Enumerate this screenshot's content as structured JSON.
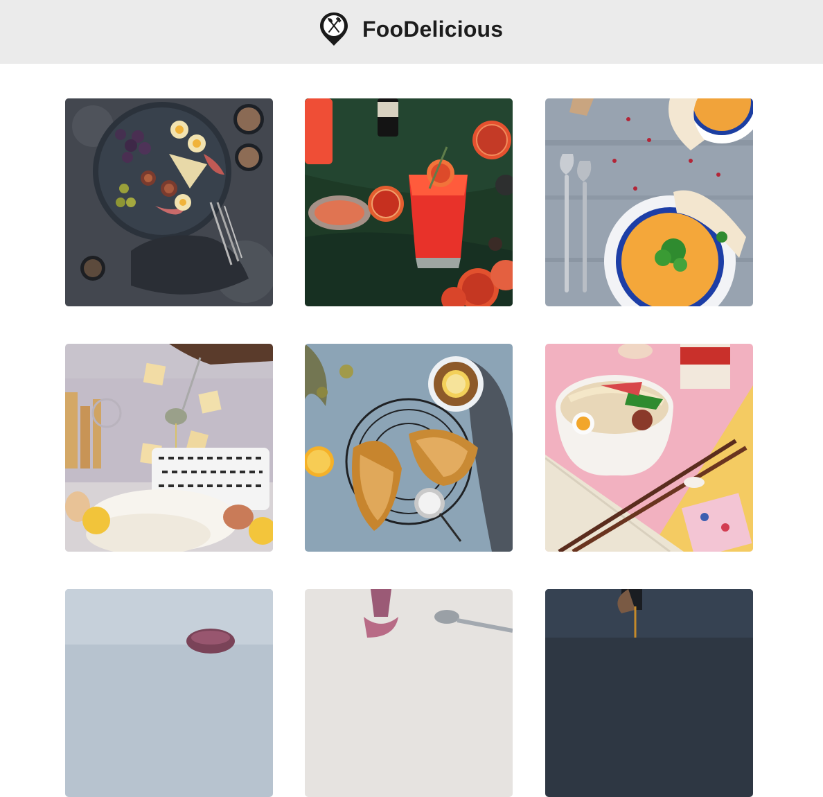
{
  "header": {
    "brand_name": "FooDelicious",
    "logo_icon": "map-pin-fork-knife-icon"
  },
  "gallery": {
    "items": [
      {
        "image": "charcuterie-platter-photo",
        "accent": "#3a3f45"
      },
      {
        "image": "blood-orange-cocktail-photo",
        "accent": "#1f3b26"
      },
      {
        "image": "pumpkin-soup-photo",
        "accent": "#8a95a3"
      },
      {
        "image": "baking-flour-splash-photo",
        "accent": "#c7c0cc"
      },
      {
        "image": "croissants-and-tea-photo",
        "accent": "#8fa5b5"
      },
      {
        "image": "ramen-bowl-chopsticks-photo",
        "accent": "#f0b6c2"
      },
      {
        "image": "wine-glass-photo",
        "accent": "#a9b7c6"
      },
      {
        "image": "dessert-and-spoon-photo",
        "accent": "#e4e1de"
      },
      {
        "image": "syrup-pour-photo",
        "accent": "#2c3440"
      }
    ]
  },
  "colors": {
    "header_bg": "#ebebeb",
    "page_bg": "#ffffff",
    "brand_text": "#1c1c1c"
  }
}
